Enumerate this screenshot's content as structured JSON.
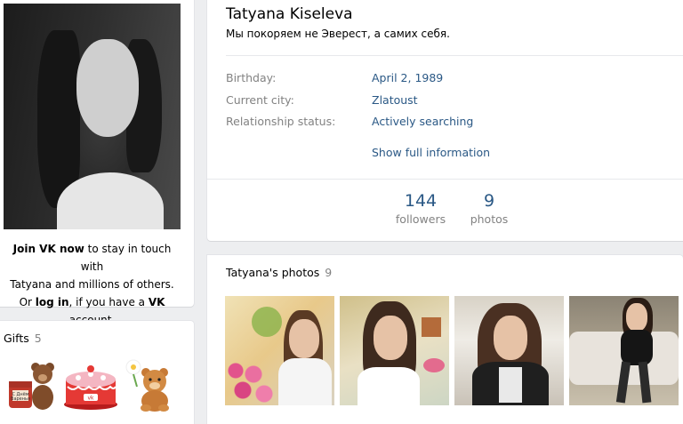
{
  "profile": {
    "name": "Tatyana Kiseleva",
    "status": "Мы покоряем не Эверест, а самих себя."
  },
  "join": {
    "join_link": "Join VK now",
    "line1_rest": " to stay in touch with",
    "line2": "Tatyana and millions of others.",
    "or": "Or ",
    "login_link": "log in",
    "if_have": ", if you have a ",
    "vk": "VK",
    "account": " account."
  },
  "info": {
    "rows": [
      {
        "label": "Birthday:",
        "value": "April 2, 1989"
      },
      {
        "label": "Current city:",
        "value": "Zlatoust"
      },
      {
        "label": "Relationship status:",
        "value": "Actively searching"
      }
    ],
    "show_full": "Show full information"
  },
  "counters": [
    {
      "num": "144",
      "label": "followers"
    },
    {
      "num": "9",
      "label": "photos"
    }
  ],
  "photos": {
    "title": "Tatyana's photos",
    "count": "9"
  },
  "gifts": {
    "title": "Gifts",
    "count": "5",
    "items": [
      "teddy-bear-gift-icon",
      "cake-gift-icon",
      "bear-with-flower-gift-icon"
    ]
  },
  "colors": {
    "link": "#2a5885",
    "muted": "#828282",
    "background": "#edeef0"
  }
}
